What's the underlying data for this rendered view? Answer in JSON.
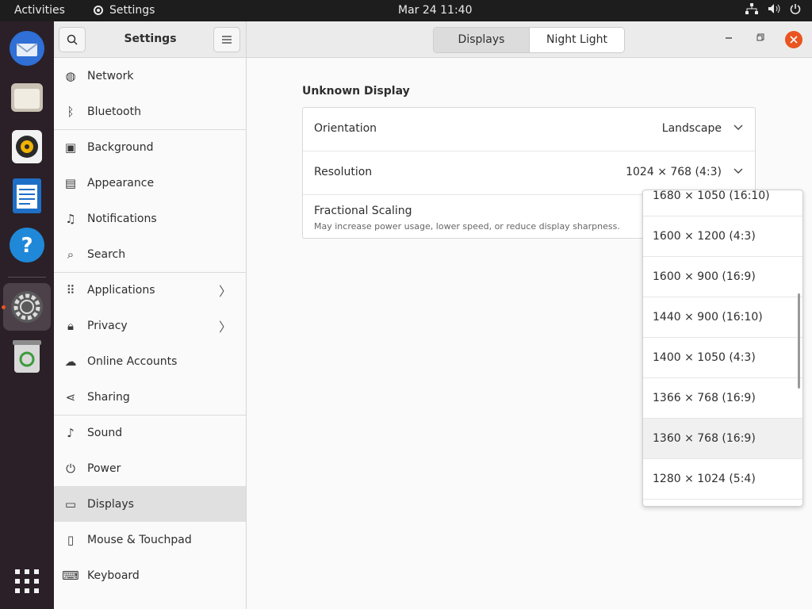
{
  "topbar": {
    "activities": "Activities",
    "app_name": "Settings",
    "clock": "Mar 24  11:40"
  },
  "dock": {
    "items": [
      "thunderbird-icon",
      "files-icon",
      "rhythmbox-icon",
      "writer-icon",
      "help-icon",
      "settings-icon",
      "trash-icon",
      "app-grid-icon"
    ]
  },
  "header": {
    "sidebar_title": "Settings",
    "tabs": [
      "Displays",
      "Night Light"
    ]
  },
  "sidebar": {
    "items": [
      {
        "label": "Network",
        "icon": "network-icon"
      },
      {
        "label": "Bluetooth",
        "icon": "bluetooth-icon"
      },
      {
        "label": "Background",
        "icon": "background-icon"
      },
      {
        "label": "Appearance",
        "icon": "appearance-icon"
      },
      {
        "label": "Notifications",
        "icon": "bell-icon"
      },
      {
        "label": "Search",
        "icon": "search-icon"
      },
      {
        "label": "Applications",
        "icon": "grid-icon"
      },
      {
        "label": "Privacy",
        "icon": "lock-icon"
      },
      {
        "label": "Online Accounts",
        "icon": "cloud-icon"
      },
      {
        "label": "Sharing",
        "icon": "share-icon"
      },
      {
        "label": "Sound",
        "icon": "music-icon"
      },
      {
        "label": "Power",
        "icon": "power-icon"
      },
      {
        "label": "Displays",
        "icon": "display-icon"
      },
      {
        "label": "Mouse & Touchpad",
        "icon": "mouse-icon"
      },
      {
        "label": "Keyboard",
        "icon": "keyboard-icon"
      }
    ]
  },
  "display": {
    "section_title": "Unknown Display",
    "orientation_label": "Orientation",
    "orientation_value": "Landscape",
    "resolution_label": "Resolution",
    "resolution_value": "1024 × 768 (4:3)",
    "scaling_label": "Fractional Scaling",
    "scaling_sub": "May increase power usage, lower speed, or reduce display sharpness."
  },
  "resolution_popover": {
    "options": [
      "1680 × 1050 (16:10)",
      "1600 × 1200 (4:3)",
      "1600 × 900 (16:9)",
      "1440 × 900 (16:10)",
      "1400 × 1050 (4:3)",
      "1366 × 768 (16:9)",
      "1360 × 768 (16:9)",
      "1280 × 1024 (5:4)"
    ],
    "highlighted": "1360 × 768 (16:9)"
  },
  "colors": {
    "accent": "#e95420",
    "dock_bg": "#2b2027",
    "topbar_bg": "#1d1d1d"
  }
}
